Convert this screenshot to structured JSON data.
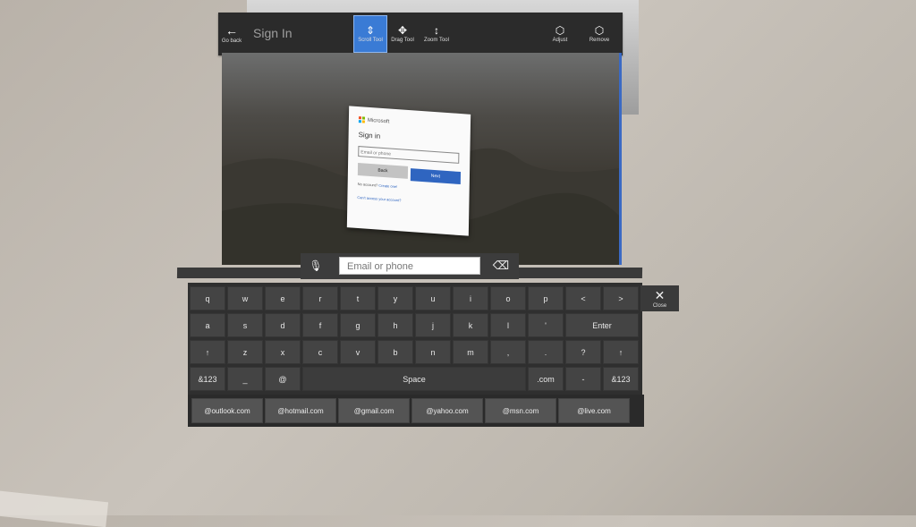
{
  "window": {
    "title": "Sign In",
    "back_label": "Go back",
    "tools": [
      {
        "label": "Scroll Tool",
        "icon": "scroll-arrows-icon",
        "active": true
      },
      {
        "label": "Drag Tool",
        "icon": "drag-move-icon",
        "active": false
      },
      {
        "label": "Zoom Tool",
        "icon": "zoom-arrows-icon",
        "active": false
      }
    ],
    "actions": [
      {
        "label": "Adjust",
        "icon": "cube-icon"
      },
      {
        "label": "Remove",
        "icon": "cube-remove-icon"
      }
    ]
  },
  "signin": {
    "brand": "Microsoft",
    "heading": "Sign in",
    "placeholder": "Email or phone",
    "back_label": "Back",
    "next_label": "Next",
    "no_account": "No account?",
    "create_link": "Create one!",
    "cant_access": "Can't access your account?"
  },
  "keyboard": {
    "input_placeholder": "Email or phone",
    "close_label": "Close",
    "rows": [
      [
        "q",
        "w",
        "e",
        "r",
        "t",
        "y",
        "u",
        "i",
        "o",
        "p",
        "<",
        ">"
      ],
      [
        "a",
        "s",
        "d",
        "f",
        "g",
        "h",
        "j",
        "k",
        "l",
        "'",
        "Enter"
      ],
      [
        "↑",
        "z",
        "x",
        "c",
        "v",
        "b",
        "n",
        "m",
        ",",
        ".",
        "?",
        "↑"
      ],
      [
        "&123",
        "_",
        "@",
        "Space",
        ".com",
        "-",
        "&123"
      ]
    ],
    "suggestions": [
      "@outlook.com",
      "@hotmail.com",
      "@gmail.com",
      "@yahoo.com",
      "@msn.com",
      "@live.com"
    ]
  }
}
